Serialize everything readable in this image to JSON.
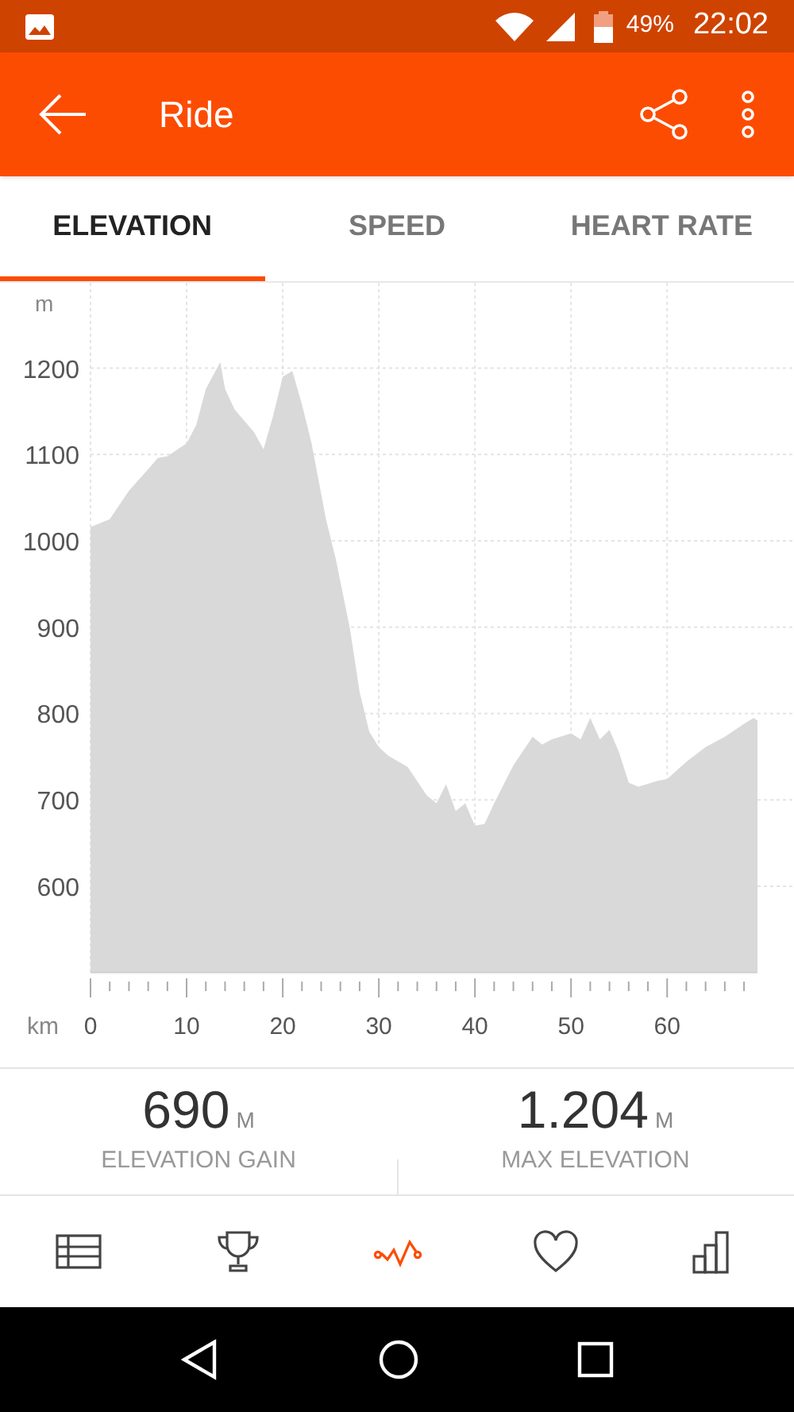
{
  "status_bar": {
    "battery": "49%",
    "time": "22:02"
  },
  "toolbar": {
    "title": "Ride"
  },
  "tabs": [
    {
      "label": "ELEVATION",
      "selected": true
    },
    {
      "label": "SPEED",
      "selected": false
    },
    {
      "label": "HEART RATE",
      "selected": false
    }
  ],
  "chart": {
    "chart_data": {
      "type": "area",
      "xlabel": "km",
      "ylabel": "m",
      "x": [
        0,
        2,
        4,
        6,
        7,
        8,
        10,
        11,
        12,
        13.5,
        14,
        15,
        17,
        18,
        19,
        20,
        21,
        22,
        23,
        24.5,
        25.5,
        27,
        28,
        29,
        30,
        31,
        33,
        35,
        36,
        37,
        38,
        39,
        40,
        41,
        42,
        43,
        44,
        46,
        47,
        48,
        50,
        51,
        52,
        53,
        54,
        55,
        56,
        57,
        59,
        60,
        62,
        64,
        66,
        68,
        69,
        69.4
      ],
      "series": [
        {
          "color": "#d9d9d9",
          "values": [
            1016,
            1025,
            1058,
            1083,
            1096,
            1098,
            1113,
            1134,
            1176,
            1207,
            1176,
            1152,
            1126,
            1106,
            1145,
            1190,
            1197,
            1158,
            1113,
            1025,
            980,
            898,
            825,
            779,
            761,
            751,
            738,
            705,
            696,
            718,
            687,
            696,
            670,
            672,
            696,
            718,
            740,
            773,
            764,
            770,
            777,
            770,
            795,
            770,
            781,
            755,
            720,
            715,
            722,
            724,
            744,
            761,
            773,
            788,
            795,
            792
          ]
        }
      ],
      "xlim": [
        0,
        69.4
      ],
      "ylim": [
        500,
        1299
      ],
      "grid": true,
      "xticks": [
        0,
        10,
        20,
        30,
        40,
        50,
        60
      ],
      "yticks": [
        600,
        700,
        800,
        900,
        1000,
        1100,
        1200
      ]
    }
  },
  "stats": [
    {
      "value": "690",
      "unit": "M",
      "label": "ELEVATION GAIN"
    },
    {
      "value": "1.204",
      "unit": "M",
      "label": "MAX ELEVATION"
    }
  ],
  "bottom_nav": [
    {
      "kind": "table",
      "selected": false
    },
    {
      "kind": "trophy",
      "selected": false
    },
    {
      "kind": "activity",
      "selected": true
    },
    {
      "kind": "heart",
      "selected": false
    },
    {
      "kind": "bars",
      "selected": false
    }
  ]
}
